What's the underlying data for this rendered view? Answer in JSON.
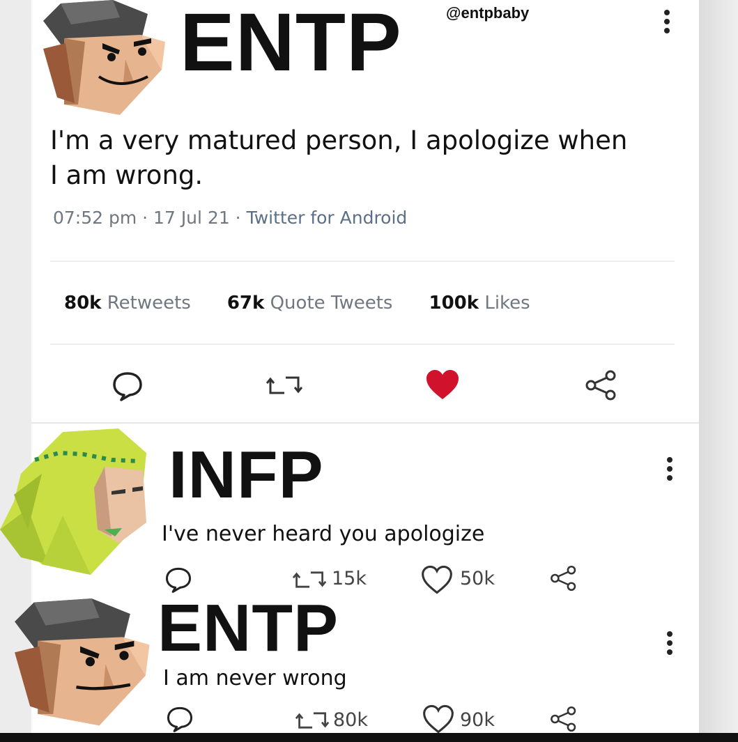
{
  "main_tweet": {
    "name": "ENTP",
    "handle": "@entpbaby",
    "text_line1": "I'm a very matured person, I apologize when",
    "text_line2": "I am wrong.",
    "time": "07:52 pm · 17 Jul 21 · ",
    "source": "Twitter for Android",
    "stats": [
      {
        "value": "80k",
        "label": "Retweets"
      },
      {
        "value": "67k",
        "label": "Quote Tweets"
      },
      {
        "value": "100k",
        "label": "Likes"
      }
    ],
    "liked": true,
    "colors": {
      "like": "#d0122c",
      "muted": "#6f7780"
    }
  },
  "reply1": {
    "name": "INFP",
    "text": "I've never heard you apologize",
    "retweets": "15k",
    "likes": "50k"
  },
  "reply2": {
    "name": "ENTP",
    "text": "I am never wrong",
    "retweets": "80k",
    "likes": "90k"
  },
  "icons": [
    "reply-icon",
    "retweet-icon",
    "heart-icon",
    "share-icon",
    "more-icon"
  ]
}
